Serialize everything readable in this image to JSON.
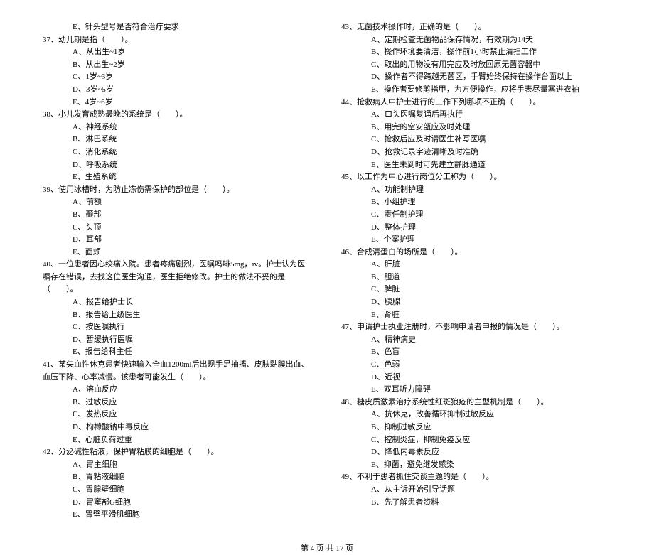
{
  "left": {
    "q36e": "E、针头型号是否符合治疗要求",
    "q37": "37、幼儿期是指（　　）。",
    "q37a": "A、从出生~1岁",
    "q37b": "B、从出生~2岁",
    "q37c": "C、1岁~3岁",
    "q37d": "D、3岁~5岁",
    "q37e": "E、4岁~6岁",
    "q38": "38、小儿发育成熟最晚的系统是（　　）。",
    "q38a": "A、神经系统",
    "q38b": "B、淋巴系统",
    "q38c": "C、消化系统",
    "q38d": "D、呼吸系统",
    "q38e": "E、生殖系统",
    "q39": "39、使用冰槽时，为防止冻伤需保护的部位是（　　）。",
    "q39a": "A、前额",
    "q39b": "B、颞部",
    "q39c": "C、头顶",
    "q39d": "D、耳部",
    "q39e": "E、面颊",
    "q40": "40、一位患者因心绞痛入院。患者疼痛剧烈，医嘱吗啡5mg，iv。护士认为医嘱存在错误，去找这位医生沟通，医生拒绝修改。护士的做法不妥的是（　　）。",
    "q40a": "A、报告给护士长",
    "q40b": "B、报告给上级医生",
    "q40c": "C、按医嘱执行",
    "q40d": "D、暂缓执行医嘱",
    "q40e": "E、报告给科主任",
    "q41": "41、某失血性休克患者快速输入全血1200ml后出现手足抽搐、皮肤黏膜出血、血压下降、心率减慢。该患者可能发生（　　）。",
    "q41a": "A、溶血反应",
    "q41b": "B、过敏反应",
    "q41c": "C、发热反应",
    "q41d": "D、枸橼酸钠中毒反应",
    "q41e": "E、心脏负荷过重",
    "q42": "42、分泌碱性粘液，保护胃粘膜的细胞是（　　）。",
    "q42a": "A、胃主细胞",
    "q42b": "B、胃粘液细胞",
    "q42c": "C、胃腺壁细胞",
    "q42d": "D、胃窦部G细胞",
    "q42e": "E、胃壁平滑肌细胞"
  },
  "right": {
    "q43": "43、无菌技术操作时，正确的是（　　）。",
    "q43a": "A、定期检查无菌物品保存情况，有效期为14天",
    "q43b": "B、操作环境要清洁，操作前1小时禁止清扫工作",
    "q43c": "C、取出的用物没有用完应及时放回原无菌容器中",
    "q43d": "D、操作者不得跨越无菌区，手臂始终保持在操作台面以上",
    "q43e": "E、操作者要修剪指甲，为方便操作，应将手表尽量塞进衣袖",
    "q44": "44、抢救病人中护士进行的工作下列哪项不正确（　　）。",
    "q44a": "A、口头医嘱复诵后再执行",
    "q44b": "B、用完的空安瓿应及时处理",
    "q44c": "C、抢救后应及时请医生补写医嘱",
    "q44d": "D、抢救记录字迹清晰及时准确",
    "q44e": "E、医生未到时可先建立静脉通道",
    "q45": "45、以工作为中心进行岗位分工称为（　　）。",
    "q45a": "A、功能制护理",
    "q45b": "B、小组护理",
    "q45c": "C、责任制护理",
    "q45d": "D、整体护理",
    "q45e": "E、个案护理",
    "q46": "46、合成清蛋白的场所是（　　）。",
    "q46a": "A、肝脏",
    "q46b": "B、胆道",
    "q46c": "C、脾脏",
    "q46d": "D、胰腺",
    "q46e": "E、肾脏",
    "q47": "47、申请护士执业注册时，不影响申请者申报的情况是（　　）。",
    "q47a": "A、精神病史",
    "q47b": "B、色盲",
    "q47c": "C、色弱",
    "q47d": "D、近视",
    "q47e": "E、双耳听力障碍",
    "q48": "48、糖皮质激素治疗系统性红斑狼疮的主型机制是（　　）。",
    "q48a": "A、抗休克，改善循环抑制过敏反应",
    "q48b": "B、抑制过敏反应",
    "q48c": "C、控制炎症，抑制免疫反应",
    "q48d": "D、降低内毒素反应",
    "q48e": "E、抑菌，避免继发感染",
    "q49": "49、不利于患者抓住交谈主题的是（　　）。",
    "q49a": "A、从主诉开始引导话题",
    "q49b": "B、先了解患者资料"
  },
  "footer": "第 4 页 共 17 页"
}
